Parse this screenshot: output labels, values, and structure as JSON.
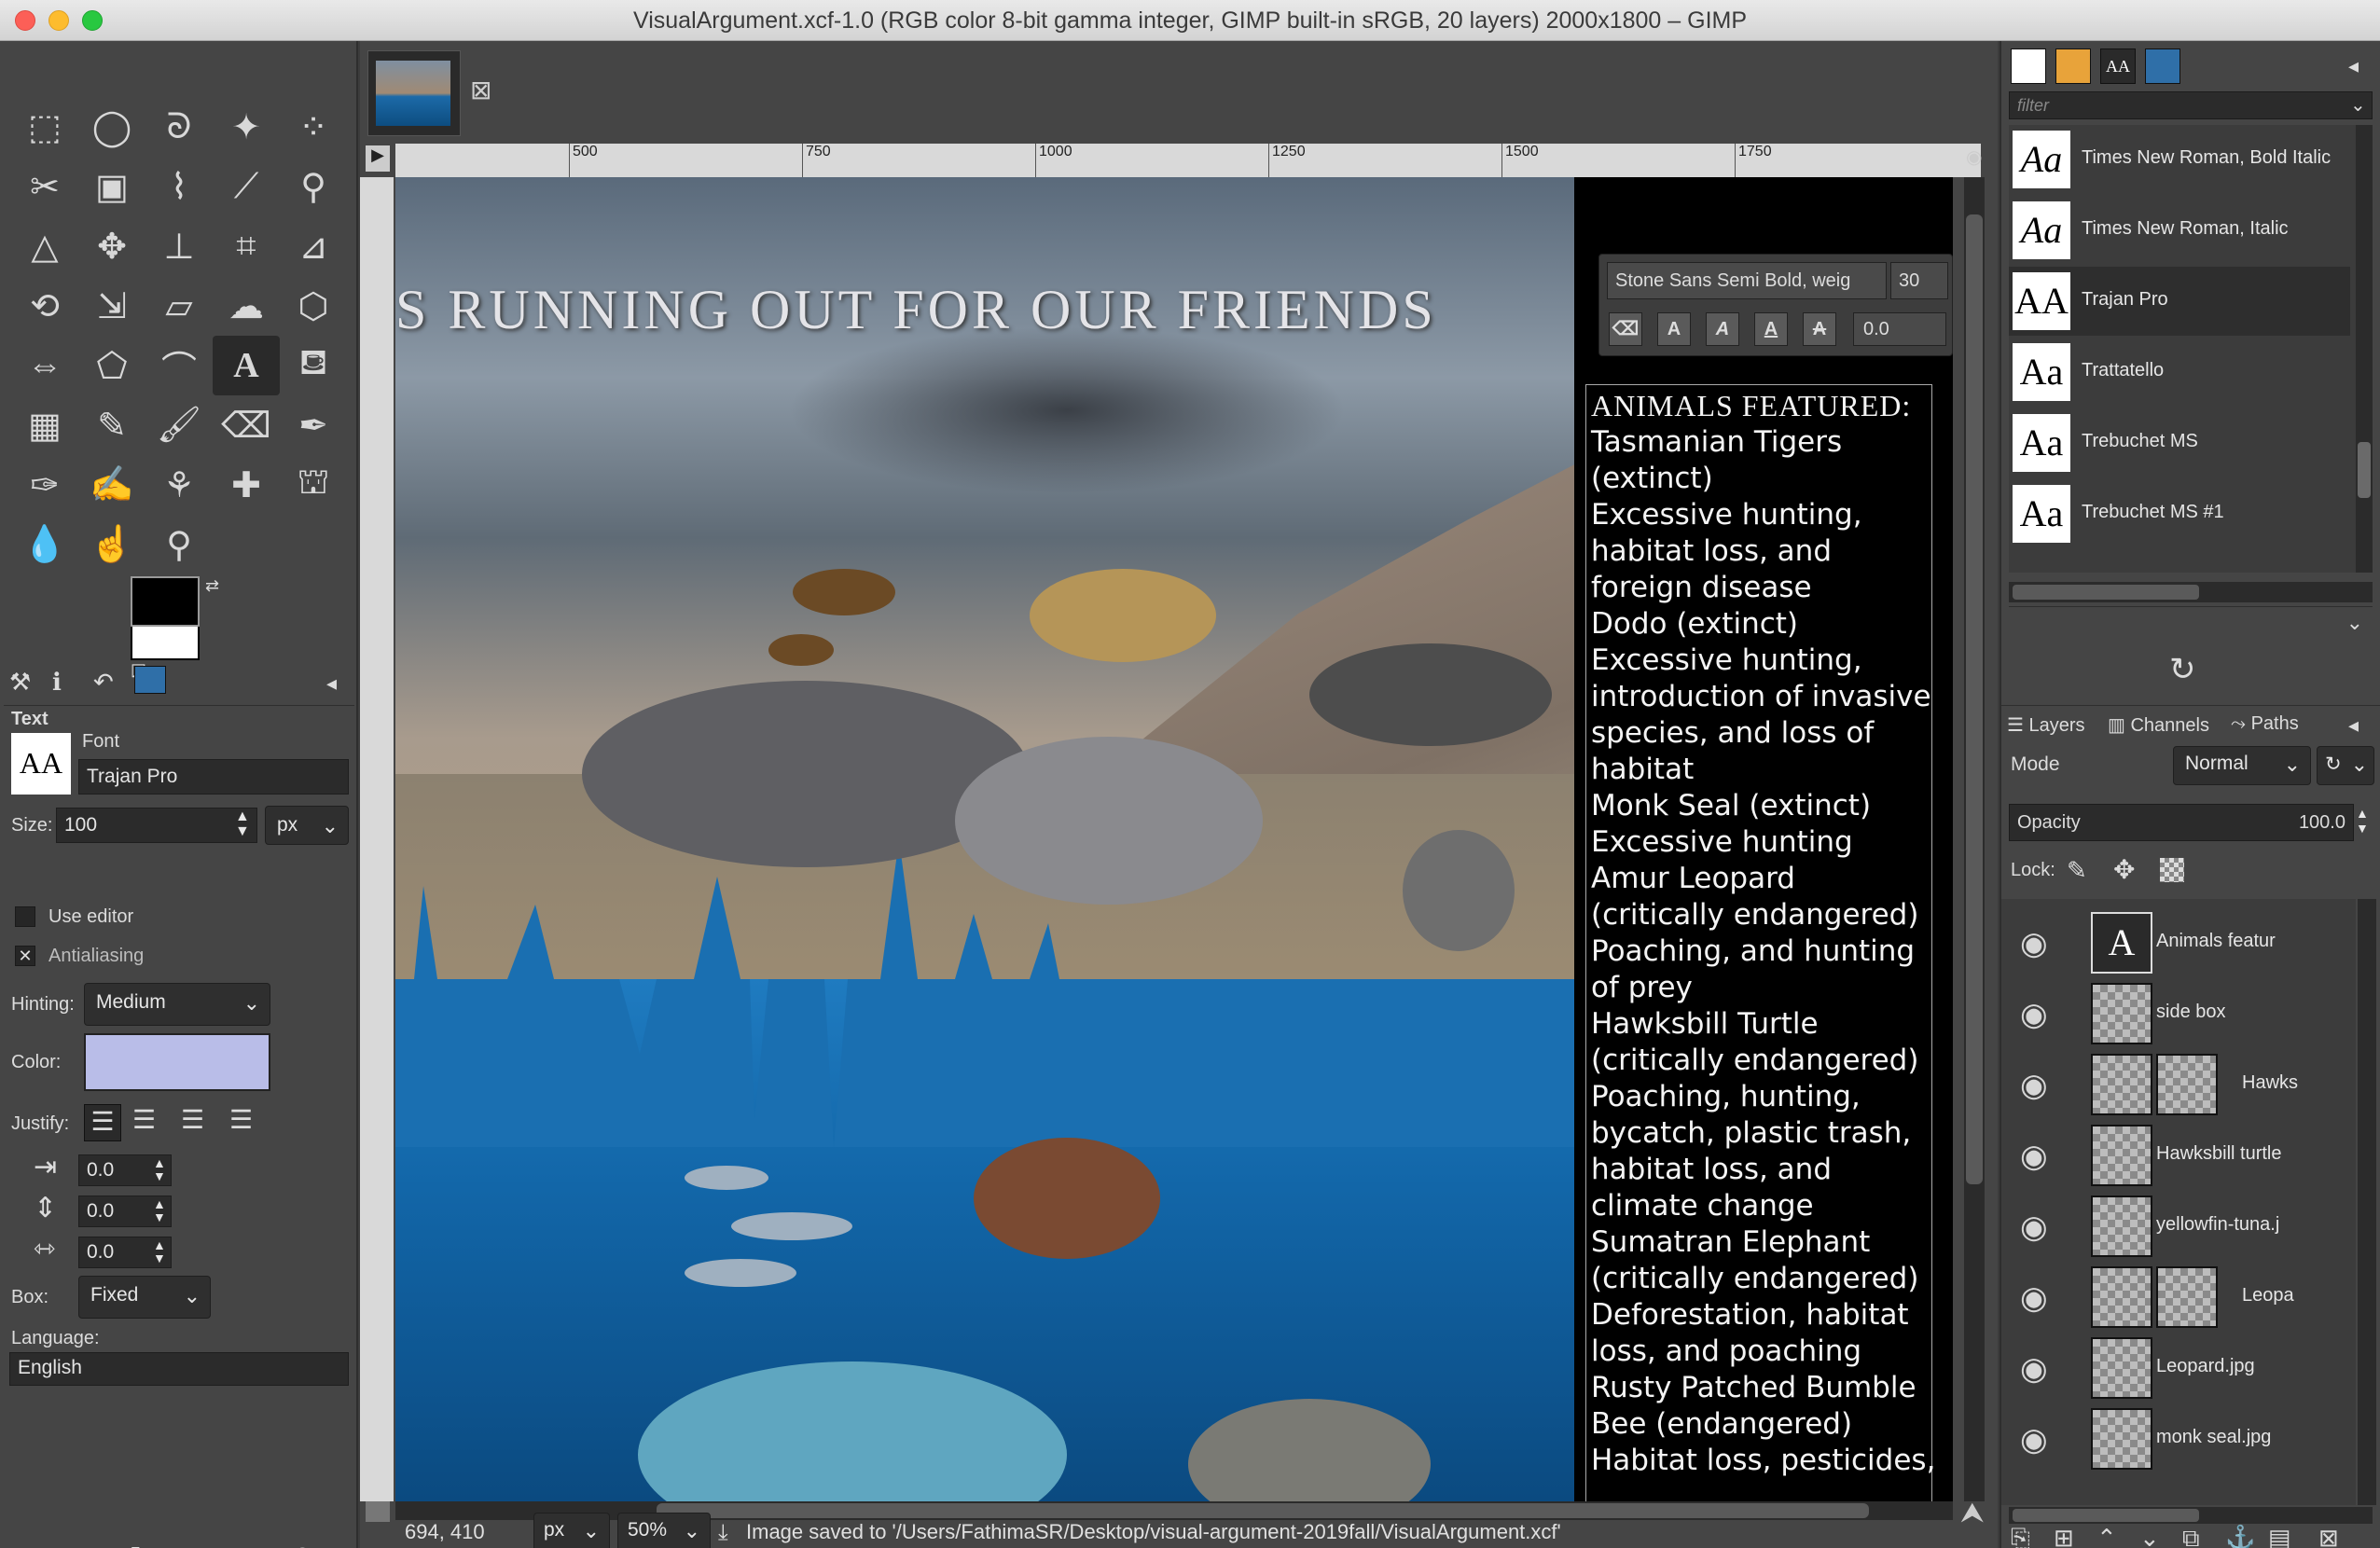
{
  "window": {
    "title": "VisualArgument.xcf-1.0 (RGB color 8-bit gamma integer, GIMP built-in sRGB, 20 layers) 2000x1800 – GIMP"
  },
  "toolbox": {
    "tool_options_title": "Text",
    "font_label": "Font",
    "font_value": "Trajan Pro",
    "font_thumb": "AA",
    "size_label": "Size:",
    "size_value": "100",
    "size_unit": "px",
    "use_editor_label": "Use editor",
    "antialiasing_label": "Antialiasing",
    "antialiasing_check": "✕",
    "hinting_label": "Hinting:",
    "hinting_value": "Medium",
    "color_label": "Color:",
    "color_swatch": "#b9bde8",
    "justify_label": "Justify:",
    "indent_value": "0.0",
    "line_spacing_value": "0.0",
    "letter_spacing_value": "0.0",
    "box_label": "Box:",
    "box_value": "Fixed",
    "language_label": "Language:",
    "language_value": "English"
  },
  "ruler": {
    "marks": [
      "500",
      "750",
      "1000",
      "1250",
      "1500",
      "1750"
    ]
  },
  "canvas": {
    "headline": "S RUNNING OUT FOR OUR FRIENDS",
    "text_toolbar": {
      "font": "Stone Sans Semi Bold, weig",
      "size": "30",
      "baseline": "0.0"
    },
    "animals_heading": "ANIMALS FEATURED:",
    "animals_lines": [
      "Tasmanian Tigers",
      "(extinct)",
      "Excessive hunting,",
      "habitat loss, and",
      "foreign disease",
      "Dodo (extinct)",
      "Excessive hunting,",
      "introduction of invasive",
      "species, and loss of",
      "habitat",
      "Monk Seal (extinct)",
      "Excessive hunting",
      "Amur Leopard",
      "(critically endangered)",
      "Poaching, and hunting",
      "of prey",
      "Hawksbill Turtle",
      "(critically endangered)",
      "Poaching, hunting,",
      "bycatch, plastic trash,",
      "habitat loss, and",
      "climate change",
      "Sumatran Elephant",
      "(critically endangered)",
      "Deforestation, habitat",
      "loss, and poaching",
      "Rusty Patched Bumble",
      "Bee (endangered)",
      "Habitat loss, pesticides,"
    ]
  },
  "status": {
    "coords": "694, 410",
    "unit": "px",
    "zoom": "50%",
    "message": "Image saved to '/Users/FathimaSR/Desktop/visual-argument-2019fall/VisualArgument.xcf'"
  },
  "dock": {
    "filter_placeholder": "filter",
    "fonts": [
      {
        "thumb": "Aa",
        "name": "Times New Roman, Bold Italic"
      },
      {
        "thumb": "Aa",
        "name": "Times New Roman, Italic"
      },
      {
        "thumb": "AA",
        "name": "Trajan Pro"
      },
      {
        "thumb": "Aa",
        "name": "Trattatello"
      },
      {
        "thumb": "Aa",
        "name": "Trebuchet MS"
      },
      {
        "thumb": "Aa",
        "name": "Trebuchet MS #1"
      }
    ],
    "tabs": {
      "layers": "Layers",
      "channels": "Channels",
      "paths": "Paths"
    },
    "mode_label": "Mode",
    "mode_value": "Normal",
    "opacity_label": "Opacity",
    "opacity_value": "100.0",
    "lock_label": "Lock:",
    "layers": [
      {
        "name": "Animals featur"
      },
      {
        "name": "side box"
      },
      {
        "name": "Hawks"
      },
      {
        "name": "Hawksbill turtle"
      },
      {
        "name": "yellowfin-tuna.j"
      },
      {
        "name": "Leopa"
      },
      {
        "name": "Leopard.jpg"
      },
      {
        "name": "monk seal.jpg"
      }
    ]
  }
}
